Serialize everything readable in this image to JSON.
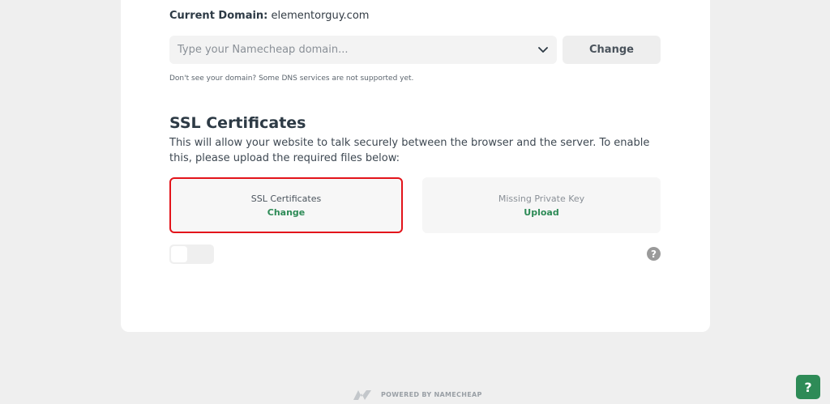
{
  "domain": {
    "current_label": "Current Domain:",
    "current_value": "elementorguy.com",
    "select_placeholder": "Type your Namecheap domain...",
    "change_label": "Change",
    "help_text": "Don't see your domain? Some DNS services are not supported yet."
  },
  "ssl": {
    "title": "SSL Certificates",
    "description": "This will allow your website to talk securely between the browser and the server. To enable this, please upload the required files below:",
    "cards": [
      {
        "label": "SSL Certificates",
        "action": "Change"
      },
      {
        "label": "Missing Private Key",
        "action": "Upload"
      }
    ],
    "toggle_on": false,
    "help_icon": "question-icon"
  },
  "footer": {
    "powered_by": "POWERED BY NAMECHEAP",
    "logo_icon": "namecheap-logo"
  },
  "support": {
    "label": "?"
  },
  "colors": {
    "accent": "#2e8b57",
    "highlight": "#e3141b"
  }
}
